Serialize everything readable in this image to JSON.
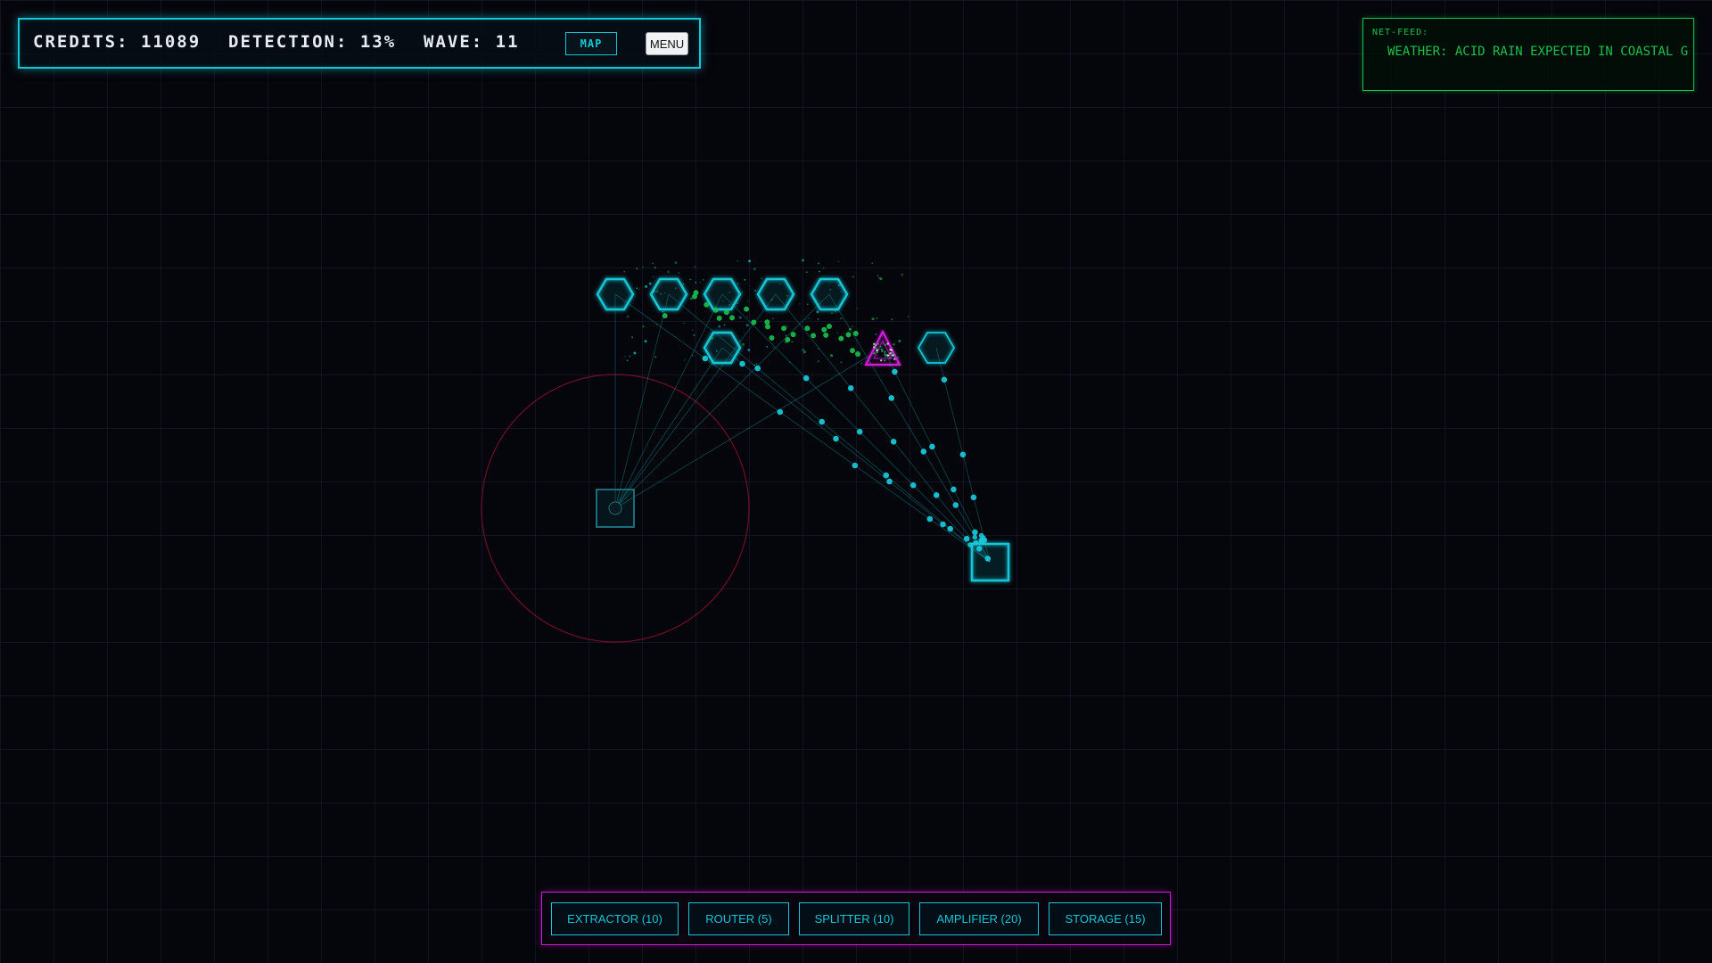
{
  "hud": {
    "credits_text": "CREDITS: 11089",
    "detection_text": "DETECTION: 13%",
    "wave_text": "WAVE: 11",
    "credits": 11089,
    "detection_percent": 13,
    "wave": 11,
    "map_label": "MAP",
    "menu_label": "MENU"
  },
  "net_feed": {
    "label": "NET-FEED:",
    "ticker": "WEATHER: ACID RAIN EXPECTED IN COASTAL G"
  },
  "build_menu": {
    "items": [
      {
        "label": "EXTRACTOR (10)",
        "cost": 10
      },
      {
        "label": "ROUTER (5)",
        "cost": 5
      },
      {
        "label": "SPLITTER (10)",
        "cost": 10
      },
      {
        "label": "AMPLIFIER (20)",
        "cost": 20
      },
      {
        "label": "STORAGE (15)",
        "cost": 15
      }
    ]
  },
  "colors": {
    "background": "#05060b",
    "grid": "#282c4e",
    "cyan": "#16c6d6",
    "green": "#19c24b",
    "magenta": "#d21ad9",
    "threat_red": "#8a1030",
    "hud_text": "#e8ecf2"
  },
  "scene": {
    "nodes": [
      {
        "type": "extractor",
        "shape": "hexagon"
      },
      {
        "type": "extractor",
        "shape": "hexagon"
      },
      {
        "type": "extractor",
        "shape": "hexagon"
      },
      {
        "type": "extractor",
        "shape": "hexagon"
      },
      {
        "type": "extractor",
        "shape": "hexagon"
      },
      {
        "type": "extractor",
        "shape": "hexagon"
      },
      {
        "type": "extractor",
        "shape": "hexagon"
      },
      {
        "type": "enemy",
        "shape": "triangle"
      },
      {
        "type": "storage",
        "shape": "square"
      },
      {
        "type": "router",
        "shape": "square"
      }
    ],
    "threat_zone": "circle"
  }
}
